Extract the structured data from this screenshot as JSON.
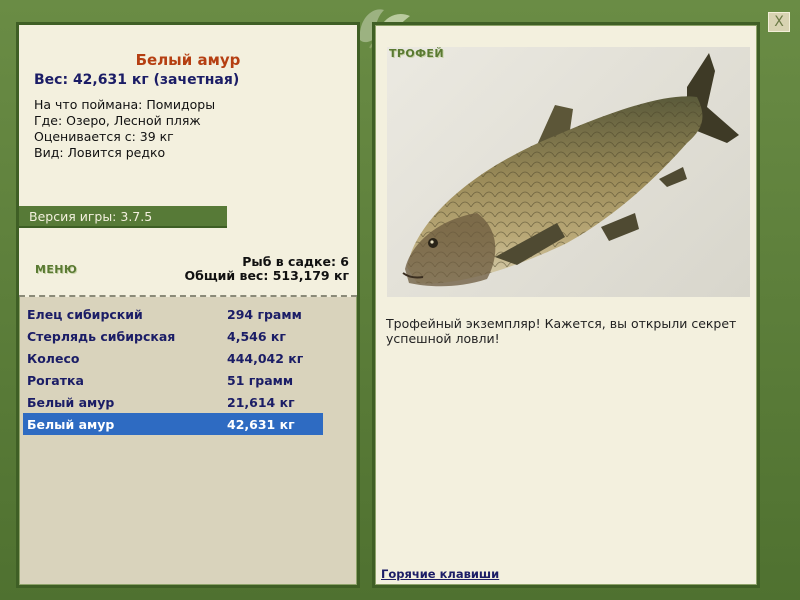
{
  "fish_info": {
    "title": "Белый амур",
    "weight": "Вес: 42,631 кг (зачетная)",
    "caught_on": "На что поймана: Помидоры",
    "location": "Где: Озеро, Лесной пляж",
    "valued_from": "Оценивается с: 39 кг",
    "rarity": "Вид: Ловится редко"
  },
  "version": "Версия игры: 3.7.5",
  "menu": {
    "label": "МЕНЮ",
    "keep_count": "Рыб в садке: 6",
    "keep_weight": "Общий вес: 513,179 кг"
  },
  "catch_list": [
    {
      "name": "Елец сибирский",
      "weight": "294 грамм"
    },
    {
      "name": "Стерлядь сибирская",
      "weight": "4,546 кг"
    },
    {
      "name": "Колесо",
      "weight": "444,042 кг"
    },
    {
      "name": "Рогатка",
      "weight": "51 грамм"
    },
    {
      "name": "Белый амур",
      "weight": "21,614 кг"
    },
    {
      "name": "Белый амур",
      "weight": "42,631 кг"
    }
  ],
  "selected_index": 5,
  "trophy": {
    "label": "ТРОФЕЙ",
    "text": "Трофейный экземпляр! Кажется, вы открыли секрет успешной ловли!"
  },
  "hotkeys_link": "Горячие клавиши",
  "close_label": "X",
  "colors": {
    "frame_green": "#577a37",
    "panel_paper": "#f3f0de",
    "list_bg": "#d9d3bc",
    "title_red": "#b53f12",
    "text_navy": "#1b1d66",
    "selected_blue": "#2e6bc2"
  }
}
